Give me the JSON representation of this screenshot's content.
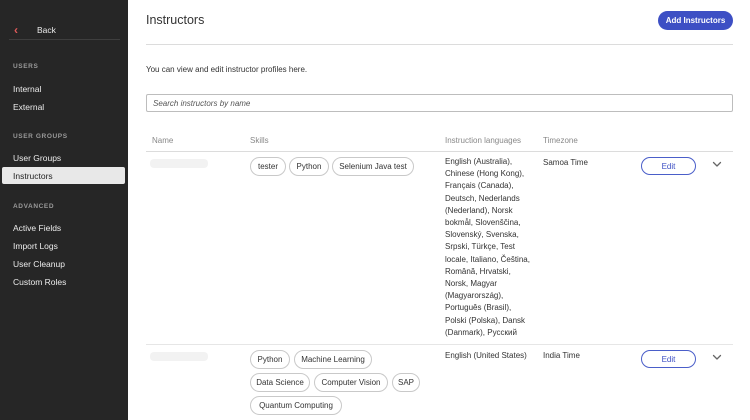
{
  "sidebar": {
    "back_label": "Back",
    "sections": [
      {
        "title": "USERS",
        "items": [
          {
            "label": "Internal"
          },
          {
            "label": "External"
          }
        ]
      },
      {
        "title": "USER GROUPS",
        "items": [
          {
            "label": "User Groups"
          },
          {
            "label": "Instructors"
          }
        ]
      },
      {
        "title": "ADVANCED",
        "items": [
          {
            "label": "Active Fields"
          },
          {
            "label": "Import Logs"
          },
          {
            "label": "User Cleanup"
          },
          {
            "label": "Custom Roles"
          }
        ]
      }
    ],
    "active_item": "Instructors"
  },
  "header": {
    "title": "Instructors",
    "add_button_label": "Add Instructors"
  },
  "intro_text": "You can view and edit instructor profiles here.",
  "search": {
    "placeholder": "Search instructors by name",
    "value": ""
  },
  "table": {
    "columns": [
      "Name",
      "Skills",
      "Instruction languages",
      "Timezone"
    ],
    "rows": [
      {
        "skills": [
          "tester",
          "Python",
          "Selenium Java test"
        ],
        "language_lines": [
          "English (Australia),",
          "Chinese (Hong Kong),",
          "Français (Canada),",
          "Deutsch, Nederlands",
          "(Nederland), Norsk",
          "bokmål, Slovenščina,",
          "Slovenský, Svenska,",
          "Srpski, Türkçe, Test",
          "locale, Italiano, Čeština,",
          "Română, Hrvatski,",
          "Norsk, Magyar",
          "(Magyarország),",
          "Português (Brasil),",
          "Polski (Polska), Dansk",
          "(Danmark), Русский"
        ],
        "timezone": "Samoa Time",
        "edit_label": "Edit"
      },
      {
        "skills": [
          "Python",
          "Machine Learning",
          "Data Science",
          "Computer Vision",
          "SAP",
          "Quantum Computing"
        ],
        "language_lines": [
          "English (United States)"
        ],
        "timezone": "India Time",
        "edit_label": "Edit"
      }
    ]
  },
  "colors": {
    "sidebar_bg": "#262626",
    "accent": "#3d4fc4",
    "back_chevron": "#e05a5a",
    "active_item_bg": "#e8e8e8"
  },
  "icons": [
    "chevron-left-icon",
    "chevron-down-icon"
  ]
}
